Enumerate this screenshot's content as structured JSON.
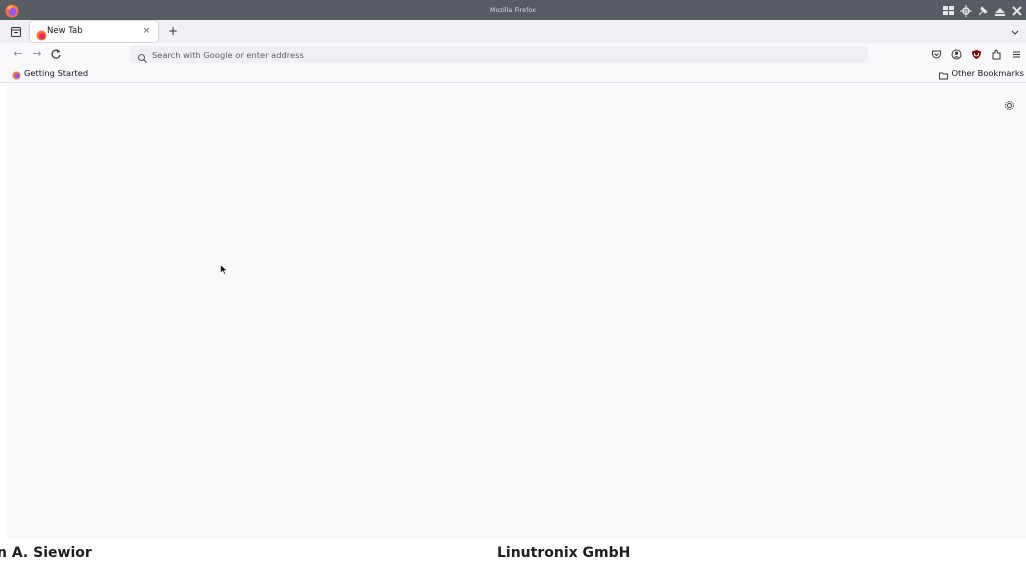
{
  "window": {
    "title": "Mozilla Firefox"
  },
  "tabs": [
    {
      "label": "New Tab",
      "active": true,
      "close_glyph": "×"
    }
  ],
  "new_tab_glyph": "+",
  "navigation": {
    "back_glyph": "←",
    "forward_glyph": "→",
    "reload_glyph": "C"
  },
  "urlbar": {
    "value": "",
    "placeholder": "Search with Google or enter address"
  },
  "toolbar_icons": [
    "pocket-icon",
    "account-icon",
    "ublock-icon",
    "extensions-icon",
    "menu-icon"
  ],
  "bookmarks": {
    "items": [
      {
        "label": "Getting Started",
        "icon": "firefox-icon"
      }
    ],
    "other_label": "Other Bookmarks"
  },
  "footer": {
    "left_text": "n A. Siewior",
    "right_text": "Linutronix GmbH"
  },
  "colors": {
    "titlebar": "#575c63",
    "tabbar": "#f0f0f4",
    "content": "#f9f9fb",
    "firefox_orange": "#ff7139",
    "firefox_purple": "#9059ff"
  }
}
